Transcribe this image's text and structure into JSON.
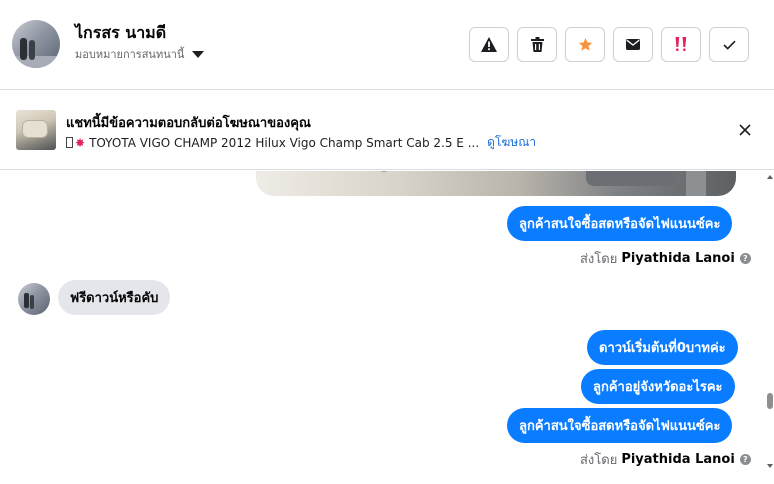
{
  "header": {
    "contact_name": "ไกรสร นามดี",
    "assign_label": "มอบหมายการสนทนานี้",
    "actions": [
      {
        "name": "report-spam-button",
        "icon": "warning-icon"
      },
      {
        "name": "delete-button",
        "icon": "trash-icon"
      },
      {
        "name": "star-button",
        "icon": "star-icon",
        "color": "#f7923e"
      },
      {
        "name": "mark-unread-button",
        "icon": "envelope-icon"
      },
      {
        "name": "follow-up-button",
        "icon": "double-exclamation-icon",
        "color": "#e0245e"
      },
      {
        "name": "mark-done-button",
        "icon": "check-icon"
      }
    ]
  },
  "ad_banner": {
    "title": "แชทนี้มีข้อความตอบกลับต่อโฆษณาของคุณ",
    "ad_text": "TOYOTA VIGO CHAMP 2012 Hilux Vigo Champ Smart Cab 2.5 E ...",
    "view_ad_link": "ดูโฆษณา"
  },
  "messages": {
    "m1": "ลูกค้าสนใจซื้อสดหรือจัดไฟแนนซ์คะ",
    "sent_by_1_prefix": "ส่งโดย",
    "sent_by_1_name": "Piyathida Lanoi",
    "m2": "ฟรีดาวน์หรือคับ",
    "m3": "ดาวน์เริ่มต้นที่0บาทค่ะ",
    "m4": "ลูกค้าอยู่จังหวัดอะไรคะ",
    "m5": "ลูกค้าสนใจซื้อสดหรือจัดไฟแนนซ์คะ",
    "sent_by_2_prefix": "ส่งโดย",
    "sent_by_2_name": "Piyathida Lanoi"
  },
  "colors": {
    "outgoing_bubble": "#0a7cff",
    "incoming_bubble": "#e4e6eb",
    "link": "#1a6ed8"
  }
}
